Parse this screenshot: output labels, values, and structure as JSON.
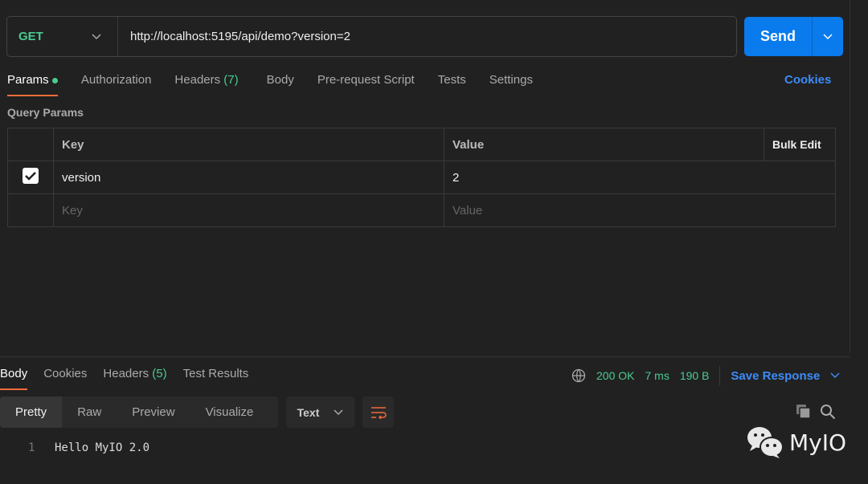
{
  "request": {
    "method": "GET",
    "url": "http://localhost:5195/api/demo?version=2",
    "send_label": "Send"
  },
  "tabs": [
    {
      "label": "Params"
    },
    {
      "label": "Authorization"
    },
    {
      "label": "Headers",
      "count": "(7)"
    },
    {
      "label": "Body"
    },
    {
      "label": "Pre-request Script"
    },
    {
      "label": "Tests"
    },
    {
      "label": "Settings"
    }
  ],
  "cookies_label": "Cookies",
  "query_params": {
    "title": "Query Params",
    "headers": {
      "key": "Key",
      "value": "Value",
      "bulk_edit": "Bulk Edit"
    },
    "rows": [
      {
        "checked": true,
        "key": "version",
        "value": "2"
      }
    ],
    "placeholder": {
      "key": "Key",
      "value": "Value"
    }
  },
  "response": {
    "tabs": [
      {
        "label": "Body"
      },
      {
        "label": "Cookies"
      },
      {
        "label": "Headers",
        "count": "(5)"
      },
      {
        "label": "Test Results"
      }
    ],
    "status": "200 OK",
    "time": "7 ms",
    "size": "190 B",
    "save_label": "Save Response",
    "views": [
      "Pretty",
      "Raw",
      "Preview",
      "Visualize"
    ],
    "format": "Text",
    "lines": [
      {
        "num": "1",
        "text": "Hello MyIO 2.0"
      }
    ]
  },
  "watermark": "MyIO",
  "colors": {
    "accent": "#f26b3a",
    "send": "#097bed",
    "success": "#49cc90",
    "link": "#3d8bf7"
  }
}
